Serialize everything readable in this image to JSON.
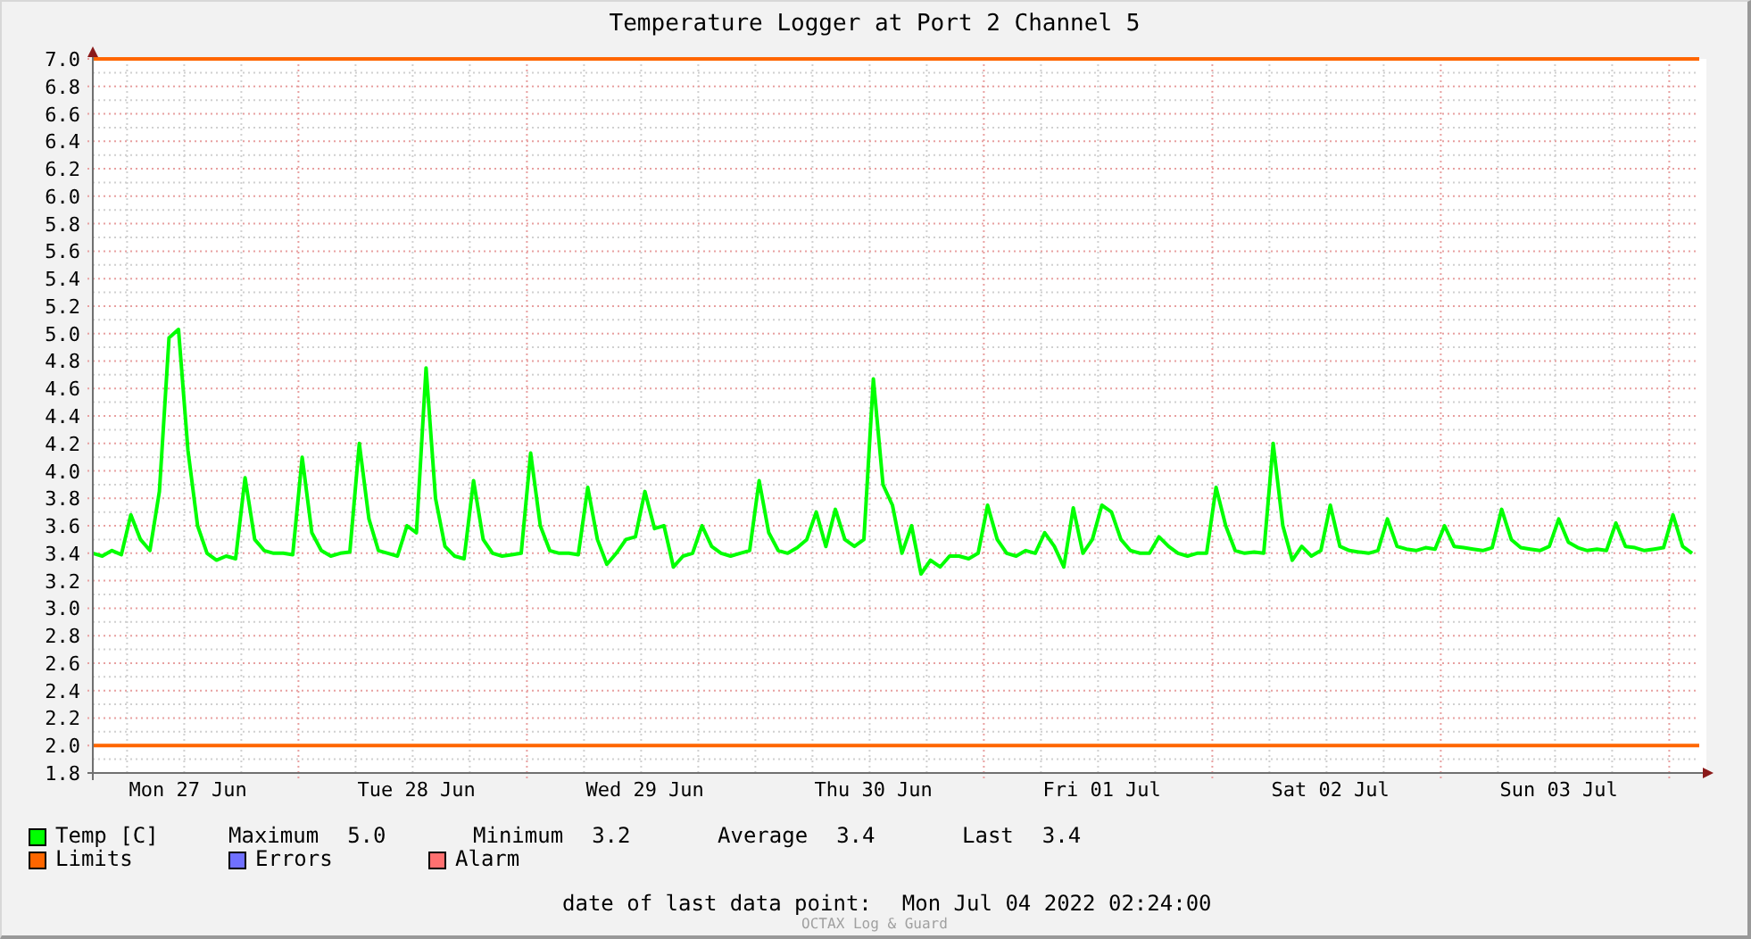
{
  "title": "Temperature Logger at Port 2 Channel 5",
  "chart_data": {
    "type": "line",
    "ylim": [
      1.8,
      7.0
    ],
    "series": [
      {
        "name": "Temp [C]",
        "color": "#00ff00",
        "values": [
          3.4,
          3.38,
          3.42,
          3.39,
          3.68,
          3.5,
          3.42,
          3.85,
          4.97,
          5.03,
          4.15,
          3.6,
          3.4,
          3.35,
          3.38,
          3.36,
          3.95,
          3.5,
          3.42,
          3.4,
          3.4,
          3.39,
          4.1,
          3.55,
          3.42,
          3.38,
          3.4,
          3.41,
          4.2,
          3.65,
          3.42,
          3.4,
          3.38,
          3.6,
          3.55,
          4.75,
          3.8,
          3.45,
          3.38,
          3.36,
          3.93,
          3.5,
          3.4,
          3.38,
          3.39,
          3.4,
          4.13,
          3.6,
          3.42,
          3.4,
          3.4,
          3.39,
          3.88,
          3.5,
          3.32,
          3.4,
          3.5,
          3.52,
          3.85,
          3.58,
          3.6,
          3.3,
          3.38,
          3.4,
          3.6,
          3.45,
          3.4,
          3.38,
          3.4,
          3.42,
          3.93,
          3.55,
          3.42,
          3.4,
          3.44,
          3.5,
          3.7,
          3.45,
          3.72,
          3.5,
          3.45,
          3.5,
          4.67,
          3.9,
          3.75,
          3.4,
          3.6,
          3.25,
          3.35,
          3.3,
          3.38,
          3.38,
          3.36,
          3.4,
          3.75,
          3.5,
          3.4,
          3.38,
          3.42,
          3.4,
          3.55,
          3.45,
          3.3,
          3.73,
          3.4,
          3.5,
          3.75,
          3.7,
          3.5,
          3.42,
          3.4,
          3.4,
          3.52,
          3.45,
          3.4,
          3.38,
          3.4,
          3.4,
          3.88,
          3.6,
          3.42,
          3.4,
          3.41,
          3.4,
          4.2,
          3.6,
          3.35,
          3.45,
          3.38,
          3.42,
          3.75,
          3.45,
          3.42,
          3.41,
          3.4,
          3.42,
          3.65,
          3.45,
          3.43,
          3.42,
          3.44,
          3.43,
          3.6,
          3.45,
          3.44,
          3.43,
          3.42,
          3.44,
          3.72,
          3.5,
          3.44,
          3.43,
          3.42,
          3.45,
          3.65,
          3.48,
          3.44,
          3.42,
          3.43,
          3.42,
          3.62,
          3.45,
          3.44,
          3.42,
          3.43,
          3.44,
          3.68,
          3.45,
          3.4
        ]
      }
    ],
    "categories": [
      null,
      null,
      null,
      null,
      null,
      null,
      null,
      null,
      null,
      null,
      "Mon 27 Jun",
      null,
      null,
      null,
      null,
      null,
      null,
      null,
      null,
      null,
      null,
      null,
      null,
      null,
      null,
      null,
      null,
      null,
      null,
      null,
      null,
      null,
      null,
      null,
      "Tue 28 Jun",
      null,
      null,
      null,
      null,
      null,
      null,
      null,
      null,
      null,
      null,
      null,
      null,
      null,
      null,
      null,
      null,
      null,
      null,
      null,
      null,
      null,
      null,
      null,
      "Wed 29 Jun",
      null,
      null,
      null,
      null,
      null,
      null,
      null,
      null,
      null,
      null,
      null,
      null,
      null,
      null,
      null,
      null,
      null,
      null,
      null,
      null,
      null,
      null,
      null,
      "Thu 30 Jun",
      null,
      null,
      null,
      null,
      null,
      null,
      null,
      null,
      null,
      null,
      null,
      null,
      null,
      null,
      null,
      null,
      null,
      null,
      null,
      null,
      null,
      null,
      null,
      "Fri 01 Jul",
      null,
      null,
      null,
      null,
      null,
      null,
      null,
      null,
      null,
      null,
      null,
      null,
      null,
      null,
      null,
      null,
      null,
      null,
      null,
      null,
      null,
      null,
      null,
      "Sat 02 Jul",
      null,
      null,
      null,
      null,
      null,
      null,
      null,
      null,
      null,
      null,
      null,
      null,
      null,
      null,
      null,
      null,
      null,
      null,
      null,
      null,
      null,
      null,
      null,
      "Sun 03 Jul",
      null,
      null,
      null,
      null,
      null,
      null,
      null,
      null,
      null,
      null,
      null,
      null,
      null,
      null
    ],
    "yticks": [
      1.8,
      {
        "value": 2,
        "label": "2.0"
      },
      2.2,
      2.4,
      2.6,
      2.8,
      {
        "value": 3,
        "label": "3.0"
      },
      3.2,
      3.4,
      3.6,
      3.8,
      {
        "value": 4,
        "label": "4.0"
      },
      4.2,
      4.4,
      4.6,
      4.8,
      {
        "value": 5,
        "label": "5.0"
      },
      5.2,
      5.4,
      5.6,
      5.8,
      {
        "value": 6,
        "label": "6.0"
      },
      6.2,
      6.4,
      6.6,
      6.8,
      {
        "value": 7,
        "label": "7.0"
      }
    ],
    "grid": true,
    "ref_lines": [
      {
        "axis": "y",
        "value": 7,
        "color": "#ff6600"
      },
      {
        "axis": "y",
        "value": 2,
        "color": "#ff6600"
      }
    ]
  },
  "stats": [
    {
      "label": "Maximum",
      "value": "5.0"
    },
    {
      "label": "Minimum",
      "value": "3.2"
    },
    {
      "label": "Average",
      "value": "3.4"
    },
    {
      "label": "Last",
      "value": "3.4"
    }
  ],
  "legend": [
    {
      "label": "Limits",
      "color": "#ff6600"
    },
    {
      "label": "Errors",
      "color": "#7070ff"
    },
    {
      "label": "Alarm",
      "color": "#ff7070"
    }
  ],
  "footer": {
    "label": "date of last data point:",
    "value": "Mon Jul 04 2022 02:24:00"
  },
  "credit": "OCTAX Log & Guard"
}
